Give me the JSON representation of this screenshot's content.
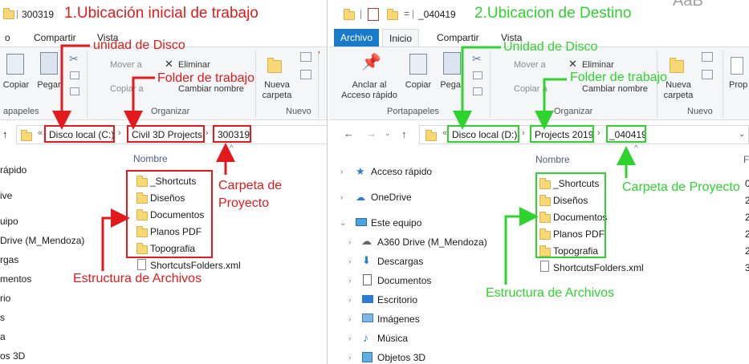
{
  "left": {
    "title": "300319",
    "tabs": [
      "o",
      "Compartir",
      "Vista"
    ],
    "ribbon": {
      "copy": "Copiar",
      "paste": "Pegar",
      "move_to": "Mover a",
      "copy_to": "Copiar a",
      "delete": "Eliminar",
      "rename": "Cambiar nombre",
      "new_folder_1": "Nueva",
      "new_folder_2": "carpeta",
      "group_clipboard": "apapeles",
      "group_organize": "Organizar",
      "group_new": "Nuevo"
    },
    "address": {
      "overflow": "«",
      "crumbs": [
        "Disco local (C:)",
        "Civil 3D Projects",
        "300319"
      ]
    },
    "column_name": "Nombre",
    "nav": [
      "rápido",
      "ive",
      "uipo",
      "Drive (M_Mendoza)",
      "rgas",
      "mentos",
      "rio",
      "s",
      "a",
      "os 3D"
    ],
    "files": [
      "_Shortcuts",
      "Diseños",
      "Documentos",
      "Planos PDF",
      "Topografia",
      "ShortcutsFolders.xml"
    ]
  },
  "right": {
    "title": "_040419",
    "tabs": [
      "Archivo",
      "Inicio",
      "Compartir",
      "Vista"
    ],
    "ribbon": {
      "pin_1": "Anclar al",
      "pin_2": "Acceso rápido",
      "copy": "Copiar",
      "paste": "Pegar",
      "move_to": "Mover a",
      "copy_to": "Copiar a",
      "delete": "Eliminar",
      "rename": "Cambiar nombre",
      "new_folder_1": "Nueva",
      "new_folder_2": "carpeta",
      "properties": "Prop",
      "group_clipboard": "Portapapeles",
      "group_organize": "Organizar",
      "group_new": "Nuevo"
    },
    "address": {
      "overflow": "«",
      "crumbs": [
        "Disco local (D:)",
        "Projects 2019",
        "_040419"
      ]
    },
    "column_name": "Nombre",
    "column_right": "F",
    "nav": [
      "Acceso rápido",
      "OneDrive",
      "Este equipo",
      "A360 Drive (M_Mendoza)",
      "Descargas",
      "Documentos",
      "Escritorio",
      "Imágenes",
      "Música",
      "Objetos 3D"
    ],
    "files": [
      "_Shortcuts",
      "Diseños",
      "Documentos",
      "Planos PDF",
      "Topografia",
      "ShortcutsFolders.xml"
    ],
    "date_frags": [
      "0",
      "2",
      "2",
      "2",
      "2",
      "3"
    ]
  },
  "annotations": {
    "left_title": "1.Ubicación inicial de trabajo",
    "left_disk": "unidad de Disco",
    "left_folder": "Folder de trabajo",
    "left_project_1": "Carpeta de",
    "left_project_2": "Proyecto",
    "left_structure": "Estructura de Archivos",
    "right_title": "2.Ubicacion de Destino",
    "right_disk": "Unidad de Disco",
    "right_folder": "Folder de trabajo",
    "right_project": "Carpeta de Proyecto",
    "right_structure": "Estructura de Archivos",
    "top_right_fragment": "AaB"
  },
  "colors": {
    "red": "#e31a1c",
    "green": "#2ed32e",
    "file_tab": "#1979ca",
    "folder": "#f8d775"
  }
}
